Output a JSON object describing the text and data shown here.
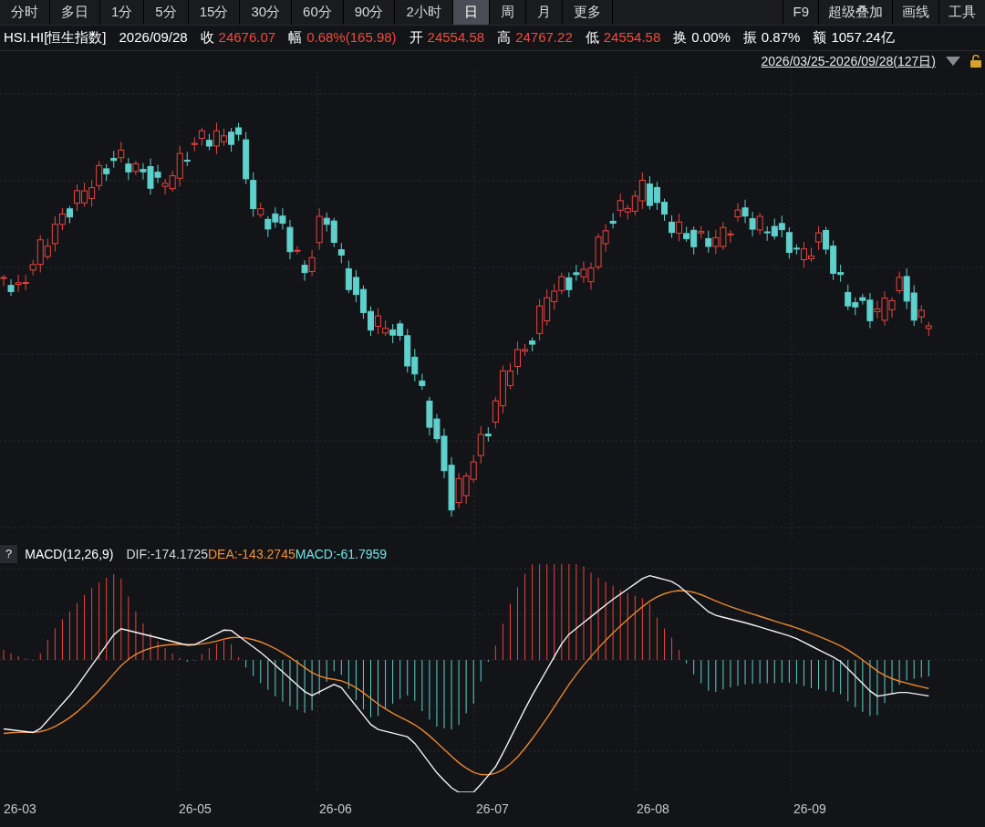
{
  "toolbar": {
    "tabs": [
      {
        "label": "分时",
        "selected": false
      },
      {
        "label": "多日",
        "selected": false
      },
      {
        "label": "1分",
        "selected": false
      },
      {
        "label": "5分",
        "selected": false
      },
      {
        "label": "15分",
        "selected": false
      },
      {
        "label": "30分",
        "selected": false
      },
      {
        "label": "60分",
        "selected": false
      },
      {
        "label": "90分",
        "selected": false
      },
      {
        "label": "2小时",
        "selected": false
      },
      {
        "label": "日",
        "selected": true
      },
      {
        "label": "周",
        "selected": false
      },
      {
        "label": "月",
        "selected": false
      },
      {
        "label": "更多",
        "selected": false
      }
    ],
    "tools": [
      "F9",
      "超级叠加",
      "画线",
      "工具"
    ]
  },
  "quote": {
    "symbol": "HSI.HI[恒生指数]",
    "date": "2026/09/28",
    "fields": [
      {
        "label": "收",
        "value": "24676.07",
        "kind": "up"
      },
      {
        "label": "幅",
        "value": "0.68%(165.98)",
        "kind": "up"
      },
      {
        "label": "开",
        "value": "24554.58",
        "kind": "up"
      },
      {
        "label": "高",
        "value": "24767.22",
        "kind": "up"
      },
      {
        "label": "低",
        "value": "24554.58",
        "kind": "up"
      },
      {
        "label": "换",
        "value": "0.00%",
        "kind": "neutral"
      },
      {
        "label": "振",
        "value": "0.87%",
        "kind": "neutral"
      },
      {
        "label": "额",
        "value": "1057.24亿",
        "kind": "neutral"
      }
    ]
  },
  "range": {
    "label": "2026/03/25-2026/09/28(127日)"
  },
  "macd": {
    "help": "?",
    "title": "MACD(12,26,9)",
    "values": [
      {
        "text": "DIF:-174.1725",
        "kind": "dif"
      },
      {
        "text": "DEA:-143.2745",
        "kind": "dea"
      },
      {
        "text": "MACD:-61.7959",
        "kind": "macd"
      }
    ]
  },
  "x_axis": [
    "26-03",
    "26-05",
    "26-06",
    "26-07",
    "26-08",
    "26-09"
  ]
}
